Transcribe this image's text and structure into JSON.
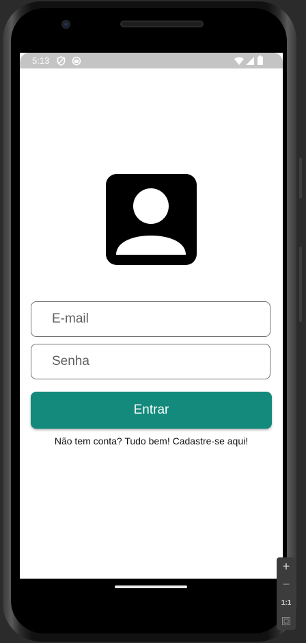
{
  "status_bar": {
    "time": "5:13",
    "left_icons": [
      "shield-icon",
      "sync-icon"
    ],
    "right_icons": [
      "wifi-icon",
      "signal-icon",
      "battery-icon"
    ]
  },
  "login": {
    "avatar_icon": "account-box-icon",
    "email_placeholder": "E-mail",
    "password_placeholder": "Senha",
    "submit_label": "Entrar",
    "signup_text": "Não tem conta? Tudo bem! Cadastre-se aqui!",
    "accent_color": "#138a7c"
  },
  "emulator_controls": {
    "zoom_in": "+",
    "zoom_out": "−",
    "actual_size": "1:1"
  }
}
